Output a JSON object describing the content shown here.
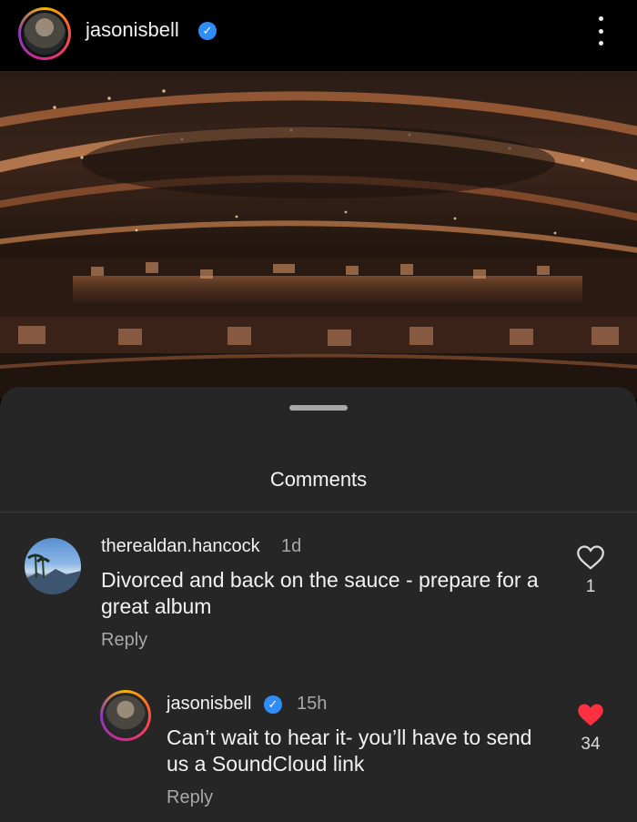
{
  "header": {
    "username": "jasonisbell",
    "verified_mark": "✓",
    "icons": [
      "avatar",
      "verified-badge-icon",
      "more-options-icon"
    ]
  },
  "post": {
    "image": "theater-balcony-photo"
  },
  "comments_sheet": {
    "title": "Comments",
    "comments": [
      {
        "username": "therealdan.hancock",
        "time": "1d",
        "text_line1": "Divorced and back on the sauce - prepare for a",
        "text_line2": "great album",
        "reply_label": "Reply",
        "likes": "1",
        "liked": false
      }
    ],
    "replies": [
      {
        "username": "jasonisbell",
        "verified_mark": "✓",
        "time": "15h",
        "text_line1": "Can’t wait to hear it- you’ll have to send",
        "text_line2": "us a SoundCloud link",
        "reply_label": "Reply",
        "likes": "34",
        "liked": true
      }
    ]
  },
  "colors": {
    "background": "#000000",
    "sheet": "#262626",
    "secondary_text": "#a8a8a8",
    "verified_blue": "#2f8df6",
    "like_red": "#ff3040"
  }
}
